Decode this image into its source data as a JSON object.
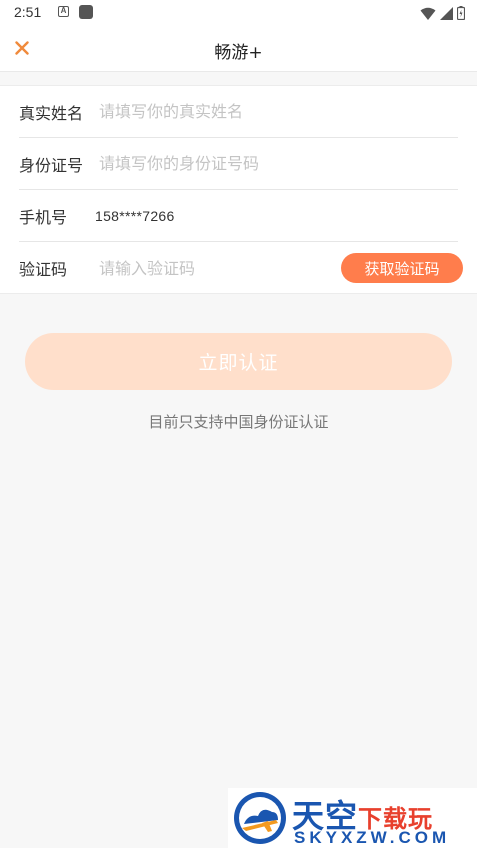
{
  "status_bar": {
    "time": "2:51",
    "icon_a": "A"
  },
  "header": {
    "title": "畅游+"
  },
  "form": {
    "name_label": "真实姓名",
    "name_placeholder": "请填写你的真实姓名",
    "id_label": "身份证号",
    "id_placeholder": "请填写你的身份证号码",
    "phone_label": "手机号",
    "phone_value": "158****7266",
    "code_label": "验证码",
    "code_placeholder": "请输入验证码",
    "get_code_button": "获取验证码"
  },
  "submit_button": "立即认证",
  "hint_text": "目前只支持中国身份证认证",
  "watermark": {
    "name_cn_1": "天空",
    "name_cn_2": "下载玩",
    "name_en": "SKYXZW.COM"
  },
  "colors": {
    "accent": "#ff7d4c",
    "accent_light": "#ffdfcb",
    "close_icon": "#f08a3c",
    "watermark_blue": "#1a56b0",
    "watermark_red": "#e8402d"
  }
}
